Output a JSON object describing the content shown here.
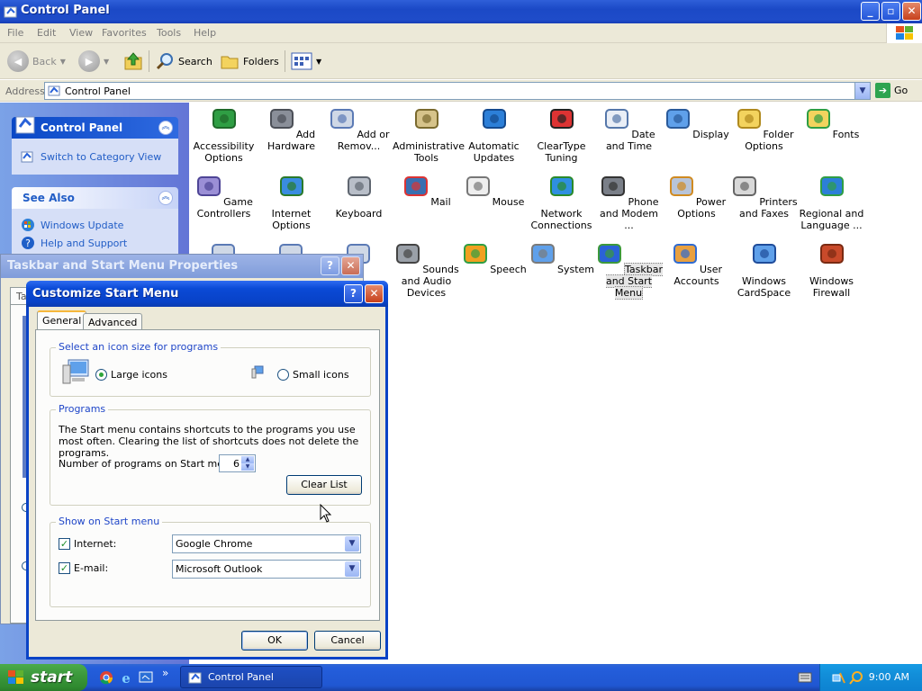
{
  "main_window": {
    "title": "Control Panel",
    "menu": [
      "File",
      "Edit",
      "View",
      "Favorites",
      "Tools",
      "Help"
    ],
    "toolbar": {
      "back": "Back",
      "search": "Search",
      "folders": "Folders"
    },
    "address": {
      "label": "Address",
      "value": "Control Panel",
      "go": "Go"
    }
  },
  "task_pane": {
    "control_panel": {
      "title": "Control Panel",
      "link": "Switch to Category View"
    },
    "see_also": {
      "title": "See Also",
      "links": [
        "Windows Update",
        "Help and Support"
      ]
    }
  },
  "icons": [
    {
      "label": "Accessibility Options",
      "icon": "accessibility-icon"
    },
    {
      "label": "Add Hardware",
      "icon": "add-hardware-icon"
    },
    {
      "label": "Add or Remov...",
      "icon": "add-remove-programs-icon"
    },
    {
      "label": "Administrative Tools",
      "icon": "administrative-tools-icon"
    },
    {
      "label": "Automatic Updates",
      "icon": "automatic-updates-icon"
    },
    {
      "label": "ClearType Tuning",
      "icon": "cleartype-icon"
    },
    {
      "label": "Date and Time",
      "icon": "date-time-icon"
    },
    {
      "label": "Display",
      "icon": "display-icon"
    },
    {
      "label": "Folder Options",
      "icon": "folder-options-icon"
    },
    {
      "label": "Fonts",
      "icon": "fonts-icon"
    },
    {
      "label": "Game Controllers",
      "icon": "game-controllers-icon"
    },
    {
      "label": "Internet Options",
      "icon": "internet-options-icon"
    },
    {
      "label": "Keyboard",
      "icon": "keyboard-icon"
    },
    {
      "label": "Mail",
      "icon": "mail-icon"
    },
    {
      "label": "Mouse",
      "icon": "mouse-icon"
    },
    {
      "label": "Network Connections",
      "icon": "network-connections-icon"
    },
    {
      "label": "Phone and Modem ...",
      "icon": "phone-modem-icon"
    },
    {
      "label": "Power Options",
      "icon": "power-options-icon"
    },
    {
      "label": "Printers and Faxes",
      "icon": "printers-faxes-icon"
    },
    {
      "label": "Regional and Language ...",
      "icon": "regional-language-icon"
    },
    {
      "label": "Sounds and Audio Devices",
      "icon": "sounds-audio-icon"
    },
    {
      "label": "Speech",
      "icon": "speech-icon"
    },
    {
      "label": "System",
      "icon": "system-icon"
    },
    {
      "label": "Taskbar and Start Menu",
      "icon": "taskbar-start-menu-icon"
    },
    {
      "label": "User Accounts",
      "icon": "user-accounts-icon"
    },
    {
      "label": "Windows CardSpace",
      "icon": "windows-cardspace-icon"
    },
    {
      "label": "Windows Firewall",
      "icon": "windows-firewall-icon"
    }
  ],
  "taskbar_props": {
    "title": "Taskbar and Start Menu Properties",
    "tab_partial": "Ta"
  },
  "customize": {
    "title": "Customize Start Menu",
    "tabs": [
      "General",
      "Advanced"
    ],
    "icon_size": {
      "legend": "Select an icon size for programs",
      "large": "Large icons",
      "small": "Small icons",
      "selected": "large"
    },
    "programs": {
      "legend": "Programs",
      "description": "The Start menu contains shortcuts to the programs you use most often. Clearing the list of shortcuts does not delete the programs.",
      "count_label": "Number of programs on Start menu:",
      "count_value": "6",
      "clear_button": "Clear List"
    },
    "show": {
      "legend": "Show on Start menu",
      "internet_label": "Internet:",
      "internet_checked": true,
      "internet_value": "Google Chrome",
      "email_label": "E-mail:",
      "email_checked": true,
      "email_value": "Microsoft Outlook"
    },
    "ok": "OK",
    "cancel": "Cancel"
  },
  "taskbar": {
    "start": "start",
    "expand": "»",
    "task": "Control Panel",
    "clock": "9:00 AM"
  },
  "colors": {
    "xp_blue": "#0a43c6",
    "start_green": "#3c993c",
    "link_blue": "#215dc6"
  }
}
